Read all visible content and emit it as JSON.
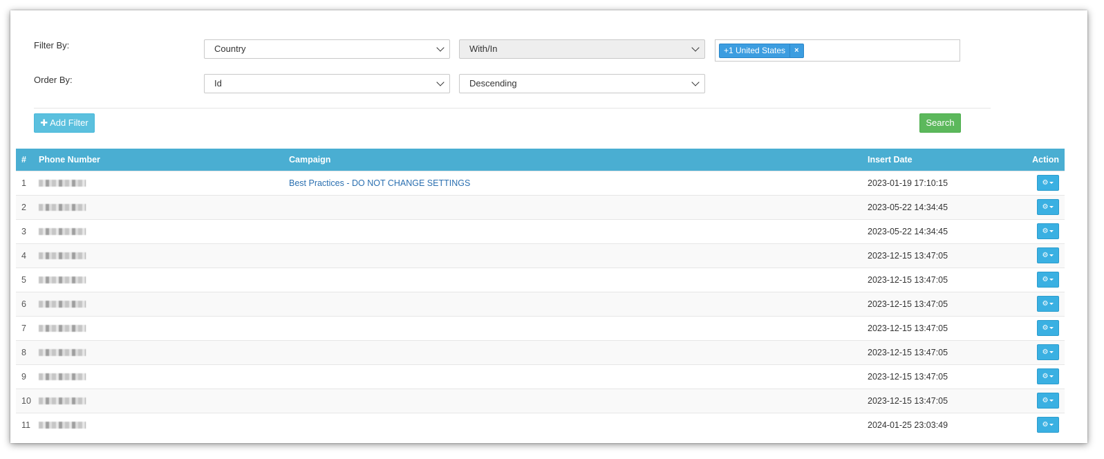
{
  "filters": {
    "filter_by_label": "Filter By:",
    "order_by_label": "Order By:",
    "filter_field": "Country",
    "filter_operator": "With/In",
    "filter_tag": "+1 United States",
    "filter_tag_remove": "×",
    "order_field": "Id",
    "order_direction": "Descending",
    "add_filter_label": "✚ Add Filter",
    "search_label": "Search"
  },
  "table": {
    "headers": [
      "#",
      "Phone Number",
      "Campaign",
      "Insert Date",
      "Action"
    ],
    "rows": [
      {
        "num": "1",
        "campaign": "Best Practices - DO NOT CHANGE SETTINGS",
        "date": "2023-01-19 17:10:15"
      },
      {
        "num": "2",
        "campaign": "",
        "date": "2023-05-22 14:34:45"
      },
      {
        "num": "3",
        "campaign": "",
        "date": "2023-05-22 14:34:45"
      },
      {
        "num": "4",
        "campaign": "",
        "date": "2023-12-15 13:47:05"
      },
      {
        "num": "5",
        "campaign": "",
        "date": "2023-12-15 13:47:05"
      },
      {
        "num": "6",
        "campaign": "",
        "date": "2023-12-15 13:47:05"
      },
      {
        "num": "7",
        "campaign": "",
        "date": "2023-12-15 13:47:05"
      },
      {
        "num": "8",
        "campaign": "",
        "date": "2023-12-15 13:47:05"
      },
      {
        "num": "9",
        "campaign": "",
        "date": "2023-12-15 13:47:05"
      },
      {
        "num": "10",
        "campaign": "",
        "date": "2023-12-15 13:47:05"
      },
      {
        "num": "11",
        "campaign": "",
        "date": "2024-01-25 23:03:49"
      }
    ],
    "action_icon": "gear-icon"
  },
  "colors": {
    "header_bg": "#4aaed2",
    "add_filter_btn": "#5bc0de",
    "search_btn": "#5cb85c",
    "tag_bg": "#3c9de0",
    "link": "#2a6fb0"
  }
}
